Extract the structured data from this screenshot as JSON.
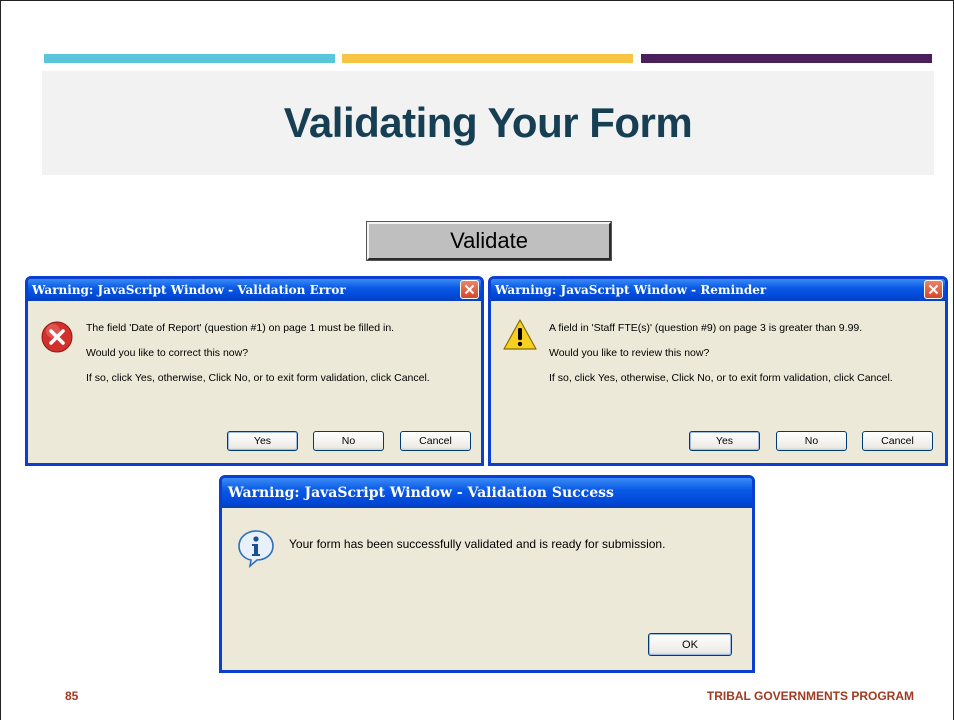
{
  "slide": {
    "title": "Validating Your Form",
    "page_number": "85",
    "footer_program": "TRIBAL GOVERNMENTS PROGRAM",
    "accent_colors": [
      "#5bc5dc",
      "#f6c342",
      "#4a1f5c"
    ]
  },
  "validate_button": {
    "label": "Validate"
  },
  "dialogs": {
    "error": {
      "title": "Warning: JavaScript Window - Validation Error",
      "icon": "error-icon",
      "lines": [
        "The field 'Date of Report' (question #1) on page 1 must be filled in.",
        "Would you like to correct this now?",
        "If so, click Yes, otherwise, Click No, or to exit form validation, click Cancel."
      ],
      "buttons": {
        "yes": "Yes",
        "no": "No",
        "cancel": "Cancel"
      }
    },
    "reminder": {
      "title": "Warning: JavaScript Window - Reminder",
      "icon": "warning-icon",
      "lines": [
        "A field in 'Staff FTE(s)' (question #9) on page 3 is greater than 9.99.",
        "Would you like to review this now?",
        "If so, click Yes, otherwise, Click No, or to exit form validation, click Cancel."
      ],
      "buttons": {
        "yes": "Yes",
        "no": "No",
        "cancel": "Cancel"
      }
    },
    "success": {
      "title": "Warning: JavaScript Window - Validation Success",
      "icon": "info-icon",
      "message": "Your form has been successfully validated and is ready for submission.",
      "buttons": {
        "ok": "OK"
      }
    }
  }
}
